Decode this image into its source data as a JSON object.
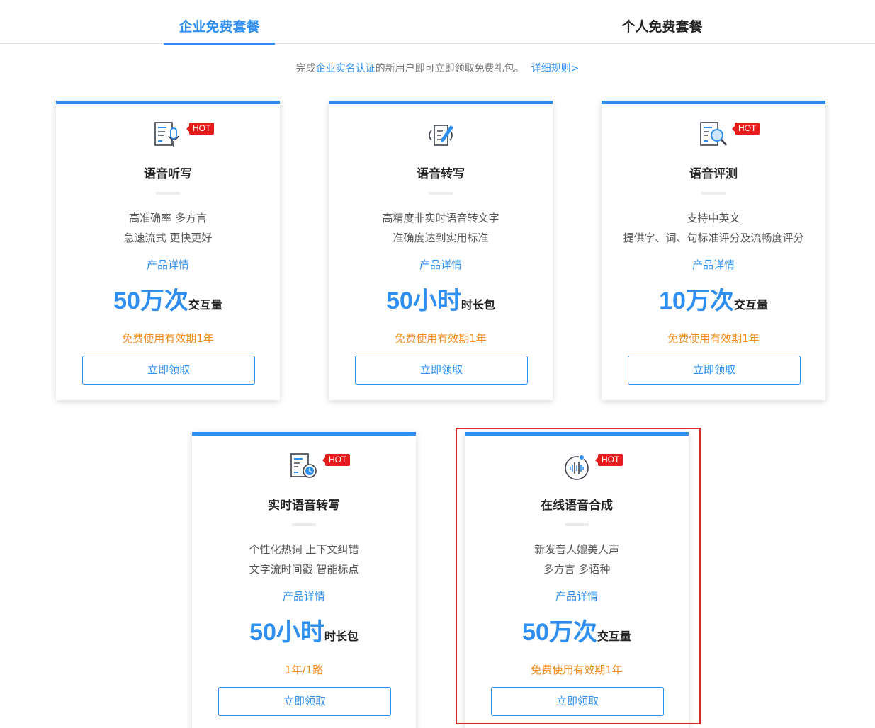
{
  "tabs": {
    "enterprise": "企业免费套餐",
    "personal": "个人免费套餐"
  },
  "notice": {
    "prefix": "完成",
    "highlight": "企业实名认证",
    "suffix": "的新用户即可立即领取免费礼包。",
    "rules_link": "详细规则>"
  },
  "colors": {
    "accent": "#2e8ff0",
    "validity": "#f08a1c",
    "hot_badge": "#e51c1c",
    "highlight_border": "#d8262b"
  },
  "cards": [
    {
      "icon": "speech-dictation-icon",
      "hot": "HOT",
      "title": "语音听写",
      "desc1": "高准确率 多方言",
      "desc2": "急速流式 更快更好",
      "detail": "产品详情",
      "amount": "50万次",
      "unit": "交互量",
      "validity": "免费使用有效期1年",
      "button": "立即领取"
    },
    {
      "icon": "speech-transcription-icon",
      "hot": "",
      "title": "语音转写",
      "desc1": "高精度非实时语音转文字",
      "desc2": "准确度达到实用标准",
      "detail": "产品详情",
      "amount": "50小时",
      "unit": "时长包",
      "validity": "免费使用有效期1年",
      "button": "立即领取"
    },
    {
      "icon": "speech-evaluation-icon",
      "hot": "HOT",
      "title": "语音评测",
      "desc1": "支持中英文",
      "desc2": "提供字、词、句标准评分及流畅度评分",
      "detail": "产品详情",
      "amount": "10万次",
      "unit": "交互量",
      "validity": "免费使用有效期1年",
      "button": "立即领取"
    },
    {
      "icon": "realtime-transcription-icon",
      "hot": "HOT",
      "title": "实时语音转写",
      "desc1": "个性化热词 上下文纠错",
      "desc2": "文字流时间戳 智能标点",
      "detail": "产品详情",
      "amount": "50小时",
      "unit": "时长包",
      "validity": "1年/1路",
      "button": "立即领取"
    },
    {
      "icon": "speech-synthesis-icon",
      "hot": "HOT",
      "title": "在线语音合成",
      "desc1": "新发音人媲美人声",
      "desc2": "多方言 多语种",
      "detail": "产品详情",
      "amount": "50万次",
      "unit": "交互量",
      "validity": "免费使用有效期1年",
      "button": "立即领取"
    }
  ]
}
